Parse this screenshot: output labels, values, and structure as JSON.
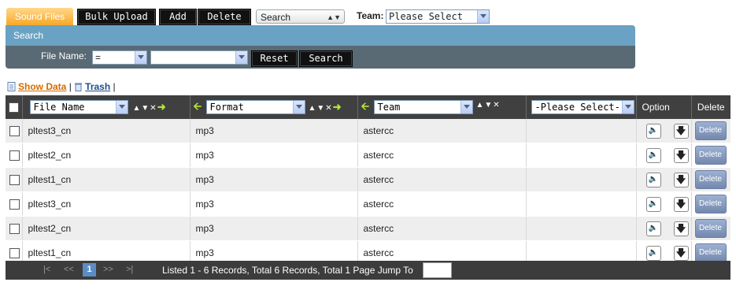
{
  "toolbar": {
    "sound_files_tab": "Sound Files",
    "bulk_upload": "Bulk Upload",
    "add": "Add",
    "delete": "Delete",
    "search_select": "Search",
    "team_label": "Team:",
    "team_select": "Please Select"
  },
  "search": {
    "header": "Search",
    "file_name_label": "File Name:",
    "operator": "=",
    "value": "",
    "reset": "Reset",
    "search": "Search"
  },
  "links": {
    "show_data": "Show Data",
    "separator1": "|",
    "trash": "Trash",
    "separator2": "|"
  },
  "table": {
    "columns": {
      "file_name": "File Name",
      "format": "Format",
      "team": "Team",
      "extra": "-Please Select-",
      "option": "Option",
      "delete": "Delete"
    },
    "rows": [
      {
        "file_name": "pltest3_cn",
        "format": "mp3",
        "team": "astercc",
        "delete": "Delete"
      },
      {
        "file_name": "pltest2_cn",
        "format": "mp3",
        "team": "astercc",
        "delete": "Delete"
      },
      {
        "file_name": "pltest1_cn",
        "format": "mp3",
        "team": "astercc",
        "delete": "Delete"
      },
      {
        "file_name": "pltest3_cn",
        "format": "mp3",
        "team": "astercc",
        "delete": "Delete"
      },
      {
        "file_name": "pltest2_cn",
        "format": "mp3",
        "team": "astercc",
        "delete": "Delete"
      },
      {
        "file_name": "pltest1_cn",
        "format": "mp3",
        "team": "astercc",
        "delete": "Delete"
      }
    ]
  },
  "pager": {
    "first": "|<",
    "prev": "<<",
    "current": "1",
    "next": ">>",
    "last": ">|",
    "status": "Listed 1 - 6 Records, Total 6 Records, Total 1 Page Jump To",
    "jump_value": ""
  },
  "colors": {
    "tab_orange": "#f7a928",
    "search_header": "#6aa2c4",
    "table_header": "#404040",
    "delete_button": "#7388ad"
  }
}
